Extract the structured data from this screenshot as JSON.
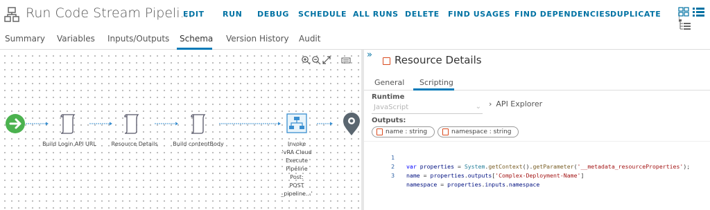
{
  "header": {
    "title": "Run Code Stream Pipeli...",
    "actions": [
      "EDIT",
      "RUN",
      "DEBUG",
      "SCHEDULE",
      "ALL RUNS",
      "DELETE",
      "FIND USAGES",
      "FIND DEPENDENCIES",
      "DUPLICATE"
    ]
  },
  "tabs": [
    "Summary",
    "Variables",
    "Inputs/Outputs",
    "Schema",
    "Version History",
    "Audit"
  ],
  "active_tab": "Schema",
  "canvas": {
    "nodes": [
      {
        "label": "Build Login API URL",
        "icon": "script-icon"
      },
      {
        "label": "Resource Details",
        "icon": "script-icon"
      },
      {
        "label": "Build contentBody",
        "icon": "script-icon"
      },
      {
        "label_lines": [
          "Invoke",
          "'vRA Cloud",
          "Execute",
          "Pipeline",
          "Post:",
          "POST",
          "_pipeline...'"
        ],
        "icon": "workflow-icon"
      }
    ],
    "start_icon": "start-arrow-icon",
    "end_icon": "end-pin-icon"
  },
  "panel": {
    "title": "Resource Details",
    "tabs": [
      "General",
      "Scripting"
    ],
    "active_tab": "Scripting",
    "runtime_label": "Runtime",
    "runtime_value": "JavaScript",
    "api_explorer": "API Explorer",
    "outputs_label": "Outputs:",
    "outputs": [
      {
        "name": "name : string"
      },
      {
        "name": "namespace : string"
      }
    ],
    "code": {
      "line_numbers": [
        "1",
        "2",
        "3"
      ],
      "lines": [
        "var properties = System.getContext().getParameter('__metadata_resourceProperties');",
        "name = properties.outputs['Complex-Deployment-Name']",
        "namespace = properties.inputs.namespace"
      ]
    }
  },
  "colors": {
    "link_blue": "#0072a3",
    "start_green": "#4bb24f",
    "pin_gray": "#5a6670",
    "script_orange": "#d9491c"
  }
}
